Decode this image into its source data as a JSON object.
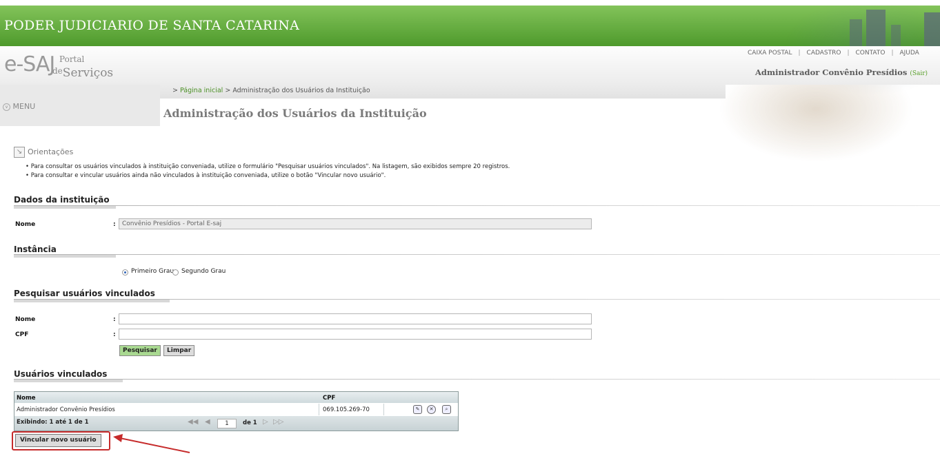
{
  "header": {
    "title": "PODER JUDICIARIO DE SANTA CATARINA",
    "logo_e": "e-SAJ",
    "logo_portal": "Portal",
    "logo_de": "de",
    "logo_servicos": "Serviços",
    "links": [
      "CAIXA POSTAL",
      "CADASTRO",
      "CONTATO",
      "AJUDA"
    ],
    "separator": "|",
    "user_name": "Administrador Convênio Presídios",
    "logout_label": "(Sair)"
  },
  "nav": {
    "menu_label": "MENU",
    "menu_icon": "chevron-down-icon",
    "breadcrumb_prefix": ">",
    "breadcrumb_home": "Página inicial",
    "breadcrumb_sep": ">",
    "breadcrumb_current": "Administração dos Usuários da Instituição"
  },
  "page": {
    "title": "Administração dos Usuários da Instituição"
  },
  "orientacoes": {
    "title": "Orientações",
    "icon": "arrow-down-right-icon",
    "items": [
      "• Para consultar os usuários vinculados à instituição conveniada, utilize o formulário \"Pesquisar usuários vinculados\". Na listagem, são exibidos sempre 20 registros.",
      "• Para consultar e vincular usuários ainda não vinculados à instituição conveniada, utilize o botão \"Vincular novo usuário\"."
    ]
  },
  "dados": {
    "title": "Dados da instituição",
    "nome_label": "Nome",
    "colon": ":",
    "nome_value": "Convênio Presídios - Portal E-saj"
  },
  "instancia": {
    "title": "Instância",
    "options": [
      "Primeiro Grau",
      "Segundo Grau"
    ],
    "selected": "Primeiro Grau"
  },
  "pesquisa": {
    "title": "Pesquisar usuários vinculados",
    "nome_label": "Nome",
    "cpf_label": "CPF",
    "colon": ":",
    "nome_value": "",
    "cpf_value": "",
    "search_button": "Pesquisar",
    "clear_button": "Limpar"
  },
  "vinculados": {
    "title": "Usuários vinculados",
    "columns": [
      "Nome",
      "CPF"
    ],
    "rows": [
      {
        "nome": "Administrador Convênio Presídios",
        "cpf": "069.105.269-70"
      }
    ],
    "row_icons": [
      "edit-icon",
      "remove-icon",
      "view-icon"
    ],
    "summary": "Exibindo: 1 até 1 de 1",
    "nav_first": "◀◀",
    "nav_prev": "◀",
    "nav_next": "▷",
    "nav_last": "▷▷",
    "page_value": "1",
    "page_total": "de 1",
    "add_button": "Vincular novo usuário"
  },
  "colors": {
    "header_green": "#5aa334",
    "link_green": "#4a8f24",
    "highlight_red": "#c62b2b"
  }
}
